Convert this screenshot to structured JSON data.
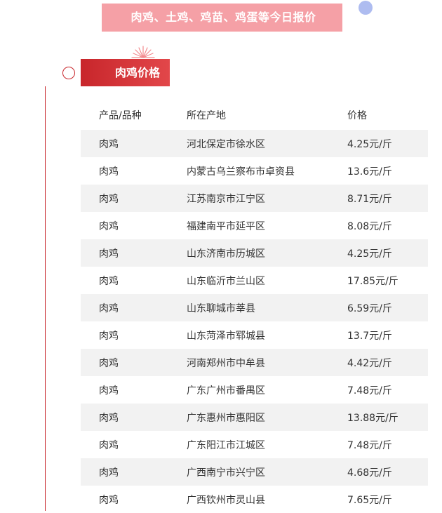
{
  "banner": {
    "title": "肉鸡、土鸡、鸡苗、鸡蛋等今日报价"
  },
  "section": {
    "title": "肉鸡价格"
  },
  "table": {
    "headers": [
      "产品/品种",
      "所在产地",
      "价格"
    ],
    "rows": [
      [
        "肉鸡",
        "河北保定市徐水区",
        "4.25元/斤"
      ],
      [
        "肉鸡",
        "内蒙古乌兰察布市卓资县",
        "13.6元/斤"
      ],
      [
        "肉鸡",
        "江苏南京市江宁区",
        "8.71元/斤"
      ],
      [
        "肉鸡",
        "福建南平市延平区",
        "8.08元/斤"
      ],
      [
        "肉鸡",
        "山东济南市历城区",
        "4.25元/斤"
      ],
      [
        "肉鸡",
        "山东临沂市兰山区",
        "17.85元/斤"
      ],
      [
        "肉鸡",
        "山东聊城市莘县",
        "6.59元/斤"
      ],
      [
        "肉鸡",
        "山东菏泽市郓城县",
        "13.7元/斤"
      ],
      [
        "肉鸡",
        "河南郑州市中牟县",
        "4.42元/斤"
      ],
      [
        "肉鸡",
        "广东广州市番禺区",
        "7.48元/斤"
      ],
      [
        "肉鸡",
        "广东惠州市惠阳区",
        "13.88元/斤"
      ],
      [
        "肉鸡",
        "广东阳江市江城区",
        "7.48元/斤"
      ],
      [
        "肉鸡",
        "广西南宁市兴宁区",
        "4.68元/斤"
      ],
      [
        "肉鸡",
        "广西钦州市灵山县",
        "7.65元/斤"
      ]
    ]
  },
  "colors": {
    "banner_bg": "#f5a0a6",
    "accent_red": "#c8262b",
    "row_alt_bg": "#f2f2f2",
    "dot_blue": "#aebcf0"
  }
}
